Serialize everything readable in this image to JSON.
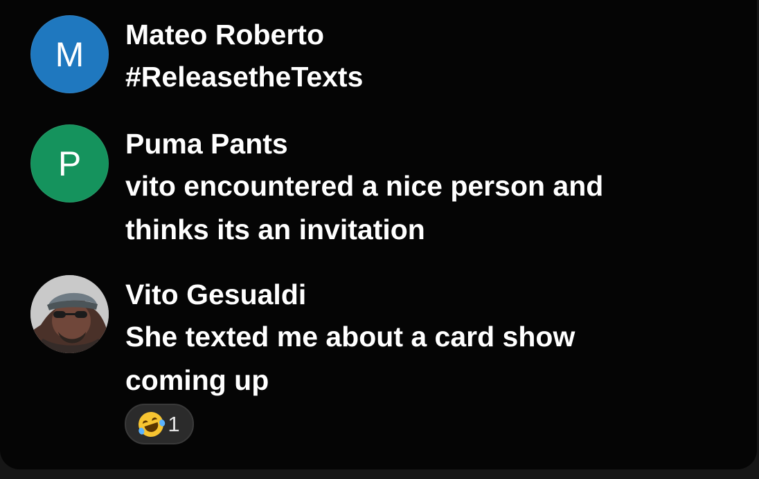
{
  "comments": [
    {
      "avatar_text": "M",
      "avatar_color": "#1f78bf",
      "username": "Mateo Roberto",
      "message": "#ReleasetheTexts"
    },
    {
      "avatar_text": "P",
      "avatar_color": "#15935d",
      "username": "Puma Pants",
      "message": "vito encountered a nice person and thinks its an invitation"
    },
    {
      "avatar_text": "",
      "avatar_icon": "profile-photo",
      "username": "Vito Gesualdi",
      "message": "She texted me about a card show coming up",
      "reaction": {
        "emoji_name": "rolling-on-floor-laughing-icon",
        "count": "1"
      }
    }
  ],
  "colors": {
    "background": "#050505",
    "text": "#ffffff",
    "reaction_background": "#2b2b2b",
    "reaction_border": "#3a3a3a"
  }
}
